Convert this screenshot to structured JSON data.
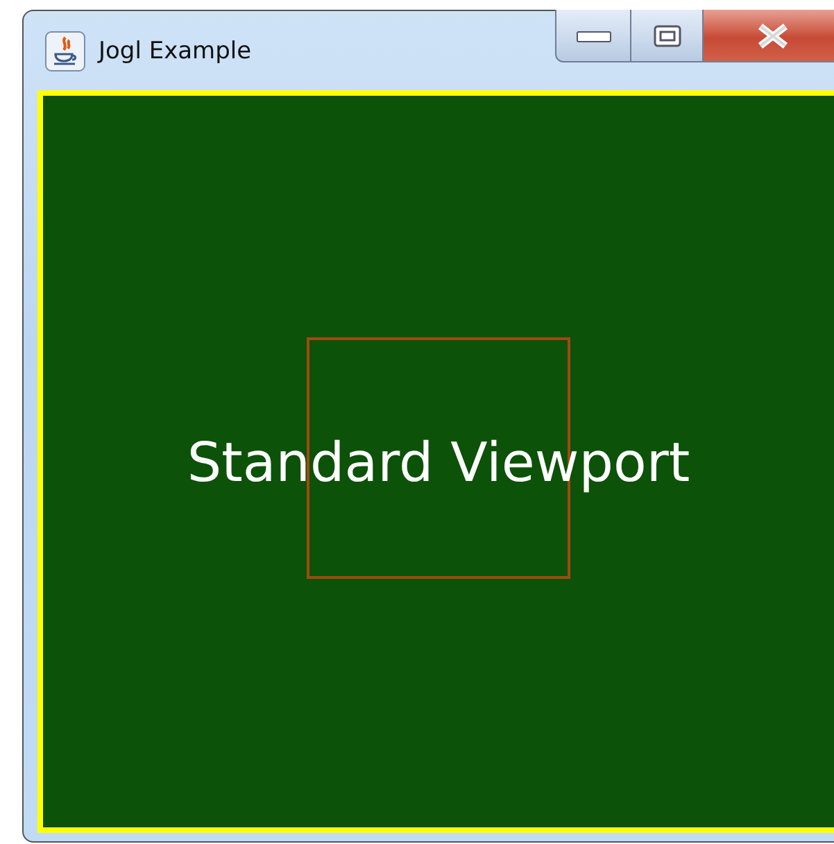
{
  "window": {
    "title": "Jogl Example"
  },
  "canvas": {
    "label": "Standard Viewport"
  }
}
